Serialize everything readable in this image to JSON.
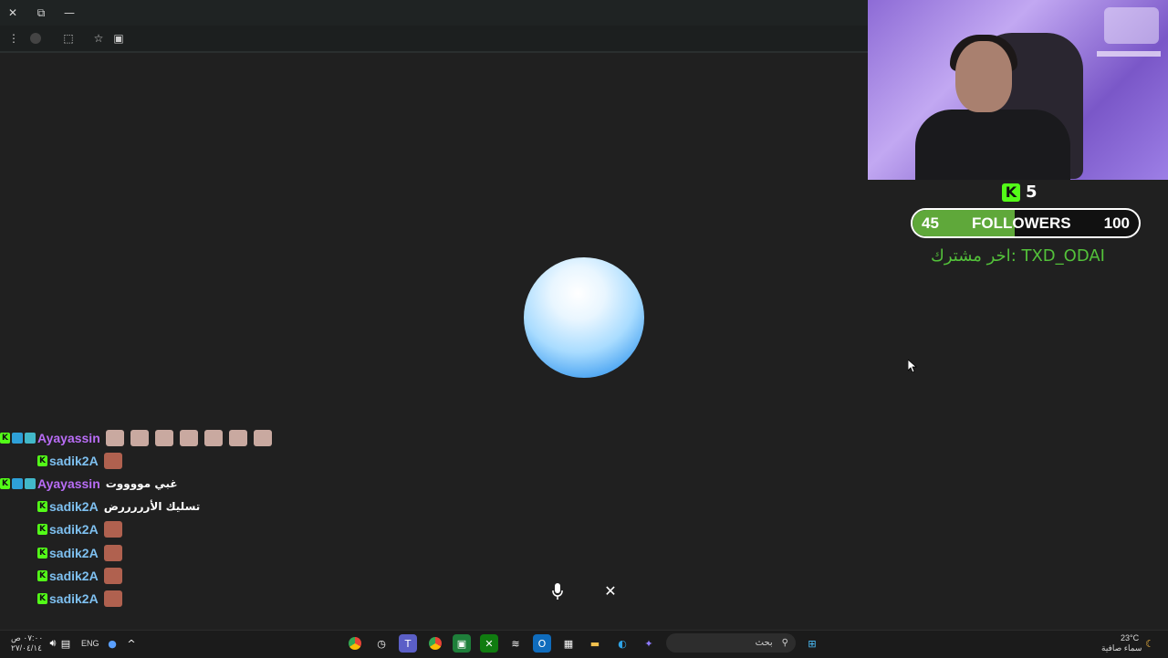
{
  "browser": {
    "url_fragment": "chat",
    "titlebar": {
      "close_icon": "close-icon",
      "restore_icon": "restore-icon",
      "minimize_icon": "minimize-icon"
    }
  },
  "overlay": {
    "subscriber_count": "5",
    "followers": {
      "current": "45",
      "label": "FOLLOWERS",
      "goal": "100",
      "progress_fraction": 0.45
    },
    "last_subscriber": "اخر مشترك: TXD_ODAI"
  },
  "chat": {
    "messages": [
      {
        "user": "Ayayassin",
        "color": "#b86cf5",
        "badges": [
          "kick",
          "arrow",
          "gift"
        ],
        "text": "",
        "emotes": 7,
        "emote_color": "#c9a9a0",
        "indent": false
      },
      {
        "user": "sadik2A",
        "color": "#7ec0f0",
        "badges": [
          "kick"
        ],
        "text": "",
        "emotes": 1,
        "emote_color": "#b0614f",
        "indent": true
      },
      {
        "user": "Ayayassin",
        "color": "#b86cf5",
        "badges": [
          "kick",
          "arrow",
          "gift"
        ],
        "text": "غبي مووووت",
        "emotes": 0,
        "indent": false
      },
      {
        "user": "sadik2A",
        "color": "#7ec0f0",
        "badges": [
          "kick"
        ],
        "text": "تسليك الأرررررض",
        "emotes": 0,
        "indent": true
      },
      {
        "user": "sadik2A",
        "color": "#7ec0f0",
        "badges": [
          "kick"
        ],
        "text": "",
        "emotes": 1,
        "emote_color": "#b0614f",
        "indent": true
      },
      {
        "user": "sadik2A",
        "color": "#7ec0f0",
        "badges": [
          "kick"
        ],
        "text": "",
        "emotes": 1,
        "emote_color": "#b0614f",
        "indent": true
      },
      {
        "user": "sadik2A",
        "color": "#7ec0f0",
        "badges": [
          "kick"
        ],
        "text": "",
        "emotes": 1,
        "emote_color": "#b0614f",
        "indent": true
      },
      {
        "user": "sadik2A",
        "color": "#7ec0f0",
        "badges": [
          "kick"
        ],
        "text": "",
        "emotes": 1,
        "emote_color": "#b0614f",
        "indent": true
      }
    ]
  },
  "voice_controls": {
    "mic_icon": "microphone-icon",
    "close_icon": "close-icon"
  },
  "taskbar": {
    "clock_time": "٠٧:٠٠ ص",
    "clock_date": "٢٧/٠٤/١٤",
    "language": "ENG",
    "search_placeholder": "بحث",
    "weather_temp": "23°C",
    "weather_text": "سماء صافية"
  },
  "colors": {
    "kick_green": "#53fc18",
    "followers_fill": "#5fa83a",
    "last_sub_text": "#53c13a"
  }
}
